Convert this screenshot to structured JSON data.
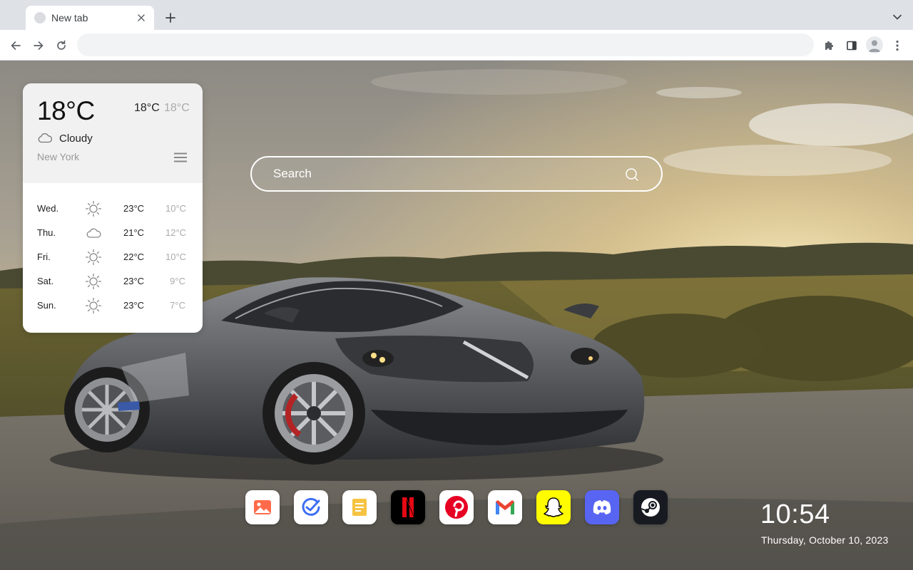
{
  "browser": {
    "tab": {
      "title": "New tab"
    },
    "omnibox": {
      "value": "",
      "placeholder": ""
    }
  },
  "weather": {
    "current_temp": "18°C",
    "high": "18°C",
    "low": "18°C",
    "condition": "Cloudy",
    "condition_icon": "cloud-icon",
    "location": "New York",
    "forecast": [
      {
        "day": "Wed.",
        "icon": "sun-icon",
        "high": "23°C",
        "low": "10°C"
      },
      {
        "day": "Thu.",
        "icon": "cloud-icon",
        "high": "21°C",
        "low": "12°C"
      },
      {
        "day": "Fri.",
        "icon": "sun-icon",
        "high": "22°C",
        "low": "10°C"
      },
      {
        "day": "Sat.",
        "icon": "sun-icon",
        "high": "23°C",
        "low": "9°C"
      },
      {
        "day": "Sun.",
        "icon": "sun-icon",
        "high": "23°C",
        "low": "7°C"
      }
    ]
  },
  "search": {
    "placeholder": "Search"
  },
  "dock": {
    "apps": [
      {
        "name": "photos",
        "icon": "photos-icon",
        "color": "#ff6b4a"
      },
      {
        "name": "tasks",
        "icon": "tasks-icon",
        "color": "#3d6ef5"
      },
      {
        "name": "notes",
        "icon": "notes-icon",
        "color": "#f6c343"
      },
      {
        "name": "netflix",
        "icon": "netflix-icon",
        "color": "#e50914"
      },
      {
        "name": "pinterest",
        "icon": "pinterest-icon",
        "color": "#e60023"
      },
      {
        "name": "gmail",
        "icon": "gmail-icon",
        "color": "#ea4335"
      },
      {
        "name": "snapchat",
        "icon": "snapchat-icon",
        "color": "#fffc00"
      },
      {
        "name": "discord",
        "icon": "discord-icon",
        "color": "#5865f2"
      },
      {
        "name": "steam",
        "icon": "steam-icon",
        "color": "#171a21"
      }
    ]
  },
  "clock": {
    "time": "10:54",
    "date": "Thursday, October 10, 2023"
  }
}
